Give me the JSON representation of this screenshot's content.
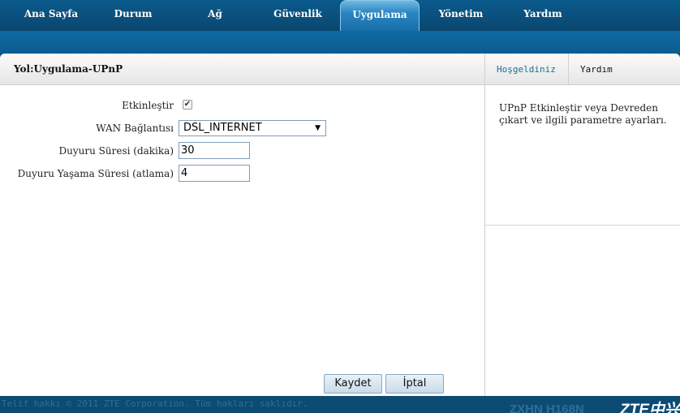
{
  "nav": {
    "items": [
      {
        "label": "Ana Sayfa"
      },
      {
        "label": "Durum"
      },
      {
        "label": "Ağ"
      },
      {
        "label": "Güvenlik"
      },
      {
        "label": "Uygulama"
      },
      {
        "label": "Yönetim"
      },
      {
        "label": "Yardım"
      }
    ],
    "active": "Uygulama"
  },
  "breadcrumb": "Yol:Uygulama-UPnP",
  "form": {
    "enable_label": "Etkinleştir",
    "enable_checked": true,
    "enable_mark": "✔",
    "wan_label": "WAN Bağlantısı",
    "wan_value": "DSL_INTERNET",
    "wan_arrow": "▼",
    "adv_time_label": "Duyuru Süresi (dakika)",
    "adv_time_value": "30",
    "adv_ttl_label": "Duyuru Yaşama Süresi (atlama)",
    "adv_ttl_value": "4"
  },
  "buttons": {
    "save": "Kaydet",
    "cancel": "İptal"
  },
  "side": {
    "tab_welcome": "Hoşgeldiniz",
    "tab_help": "Yardım",
    "help_text": "UPnP Etkinleştir veya Devreden çıkart ve ilgili parametre ayarları."
  },
  "footer": {
    "copyright": "Telif hakkı © 2011 ZTE Corporation. Tüm hakları saklıdır.",
    "model": "ZXHN H168N",
    "brand": "ZTE中兴"
  },
  "colors": {
    "header_bg": "#0b4f7c",
    "active_tab": "#2a86c2",
    "side_tab_text": "#1a6a9a"
  }
}
